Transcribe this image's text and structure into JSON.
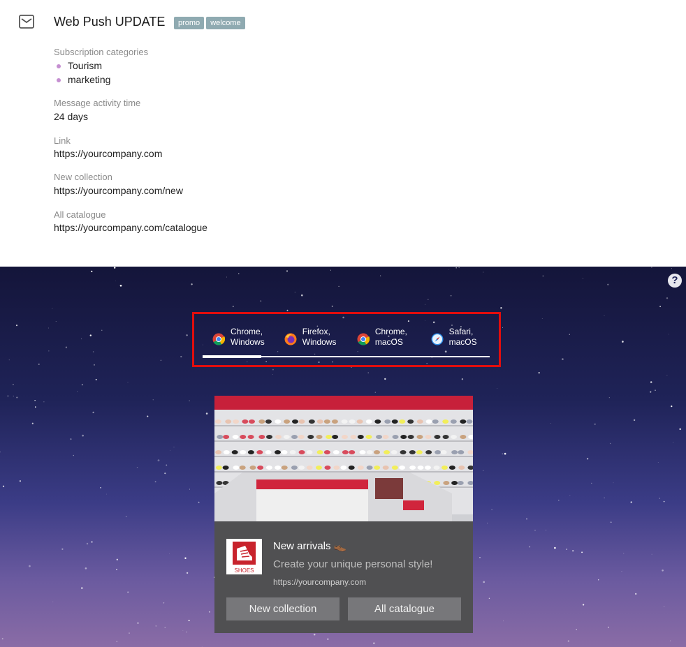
{
  "message": {
    "title": "Web Push UPDATE",
    "tags": [
      "promo",
      "welcome"
    ],
    "icon": "mail-icon"
  },
  "fields": {
    "subscription_label": "Subscription categories",
    "categories": [
      "Tourism",
      "marketing"
    ],
    "activity_label": "Message activity time",
    "activity_value": "24 days",
    "link_label": "Link",
    "link_value": "https://yourcompany.com",
    "new_collection_label": "New collection",
    "new_collection_value": "https://yourcompany.com/new",
    "all_catalogue_label": "All catalogue",
    "all_catalogue_value": "https://yourcompany.com/catalogue"
  },
  "preview": {
    "help_icon": "question-icon",
    "help_symbol": "?",
    "tabs": [
      {
        "label": "Chrome,\nWindows",
        "icon": "chrome-icon"
      },
      {
        "label": "Firefox,\nWindows",
        "icon": "firefox-icon"
      },
      {
        "label": "Chrome,\nmacOS",
        "icon": "chrome-icon"
      },
      {
        "label": "Safari,\nmacOS",
        "icon": "safari-icon"
      }
    ],
    "active_tab": 0,
    "highlight_color": "#e20d0d",
    "notification": {
      "title": "New arrivals 👞",
      "body": "Create your unique personal style!",
      "url": "https://yourcompany.com",
      "logo_text": "SHOES",
      "buttons": [
        "New collection",
        "All catalogue"
      ]
    }
  }
}
